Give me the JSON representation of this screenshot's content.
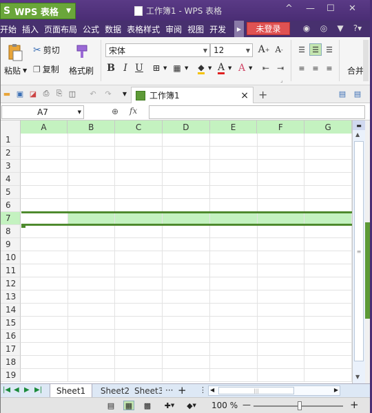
{
  "app": {
    "logo": "S",
    "name": "WPS 表格",
    "doc_title": "工作簿1 - WPS 表格"
  },
  "window_controls": {
    "restore": "^",
    "minimize": "—",
    "maximize": "☐",
    "close": "✕"
  },
  "menu": [
    "开始",
    "插入",
    "页面布局",
    "公式",
    "数据",
    "表格样式",
    "审阅",
    "视图",
    "开发"
  ],
  "login_label": "未登录",
  "top_icons": [
    "skin-icon",
    "help-center-icon",
    "shirt-icon",
    "help-icon"
  ],
  "help_label": "?",
  "ribbon": {
    "paste_label": "粘贴",
    "cut_label": "剪切",
    "copy_label": "复制",
    "format_painter_label": "格式刷",
    "font_name": "宋体",
    "font_size": "12",
    "bold": "B",
    "italic": "I",
    "underline": "U",
    "merge_label": "合并"
  },
  "qat": {
    "doc_tab": "工作簿1",
    "close": "×",
    "add": "+"
  },
  "formula_bar": {
    "cell_ref": "A7",
    "fx": "fx",
    "value": ""
  },
  "columns": [
    "A",
    "B",
    "C",
    "D",
    "E",
    "F",
    "G"
  ],
  "rows": [
    "1",
    "2",
    "3",
    "4",
    "5",
    "6",
    "7",
    "8",
    "9",
    "10",
    "11",
    "12",
    "13",
    "14",
    "15",
    "16",
    "17",
    "18",
    "19"
  ],
  "selected_row": "7",
  "sheets": [
    {
      "name": "Sheet1",
      "active": true
    },
    {
      "name": "Sheet2",
      "active": false
    },
    {
      "name": "Sheet3",
      "active": false
    }
  ],
  "sheet_more": "···",
  "sheet_add": "+",
  "zoom": {
    "label": "100 %",
    "percent": 100,
    "minus": "—",
    "plus": "+"
  },
  "colors": {
    "title_bg": "#4a2d74",
    "app_btn": "#6aa63a",
    "login": "#e05252",
    "selection": "#4e8a2e",
    "highlight": "#c4f2c0"
  }
}
